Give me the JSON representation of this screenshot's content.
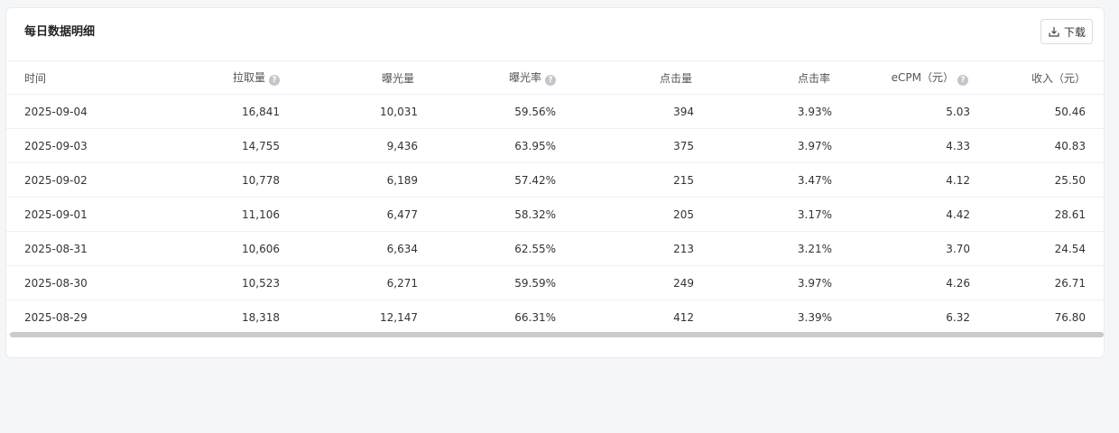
{
  "card": {
    "title": "每日数据明细",
    "download_label": "下载"
  },
  "table": {
    "headers": [
      {
        "label": "时间",
        "help": false
      },
      {
        "label": "拉取量",
        "help": true
      },
      {
        "label": "曝光量",
        "help": false
      },
      {
        "label": "曝光率",
        "help": true
      },
      {
        "label": "点击量",
        "help": false
      },
      {
        "label": "点击率",
        "help": false
      },
      {
        "label": "eCPM（元）",
        "help": true
      },
      {
        "label": "收入（元）",
        "help": false
      }
    ],
    "rows": [
      [
        "2025-09-04",
        "16,841",
        "10,031",
        "59.56%",
        "394",
        "3.93%",
        "5.03",
        "50.46"
      ],
      [
        "2025-09-03",
        "14,755",
        "9,436",
        "63.95%",
        "375",
        "3.97%",
        "4.33",
        "40.83"
      ],
      [
        "2025-09-02",
        "10,778",
        "6,189",
        "57.42%",
        "215",
        "3.47%",
        "4.12",
        "25.50"
      ],
      [
        "2025-09-01",
        "11,106",
        "6,477",
        "58.32%",
        "205",
        "3.17%",
        "4.42",
        "28.61"
      ],
      [
        "2025-08-31",
        "10,606",
        "6,634",
        "62.55%",
        "213",
        "3.21%",
        "3.70",
        "24.54"
      ],
      [
        "2025-08-30",
        "10,523",
        "6,271",
        "59.59%",
        "249",
        "3.97%",
        "4.26",
        "26.71"
      ],
      [
        "2025-08-29",
        "18,318",
        "12,147",
        "66.31%",
        "412",
        "3.39%",
        "6.32",
        "76.80"
      ]
    ]
  },
  "scrollbar": {
    "thumb_fraction": 1.0
  },
  "icons": {
    "download": "download-icon",
    "help": "help-circle-icon"
  }
}
